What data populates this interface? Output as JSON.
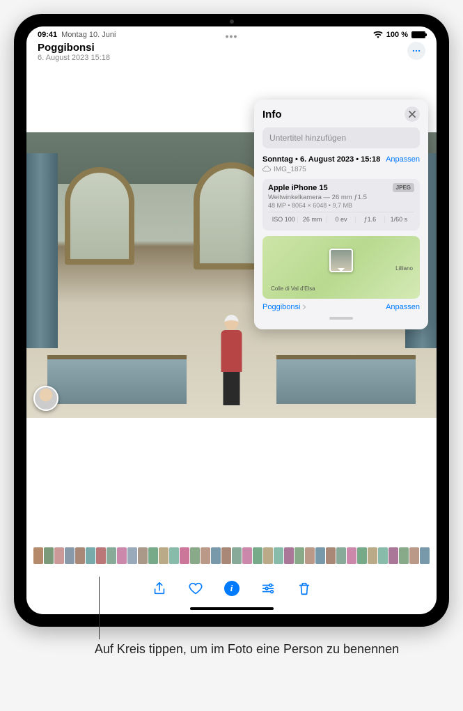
{
  "status": {
    "time": "09:41",
    "date": "Montag 10. Juni",
    "battery": "100 %"
  },
  "header": {
    "location": "Poggibonsi",
    "datetime": "6. August 2023  15:18"
  },
  "info_panel": {
    "title": "Info",
    "subtitle_placeholder": "Untertitel hinzufügen",
    "date_line": "Sonntag • 6. August 2023 • 15:18",
    "adjust": "Anpassen",
    "filename": "IMG_1875",
    "device": "Apple iPhone 15",
    "format_badge": "JPEG",
    "lens": "Weitwinkelkamera — 26 mm ƒ1.5",
    "resolution": "48 MP • 8064 × 6048 • 9,7 MB",
    "exif": {
      "iso": "ISO 100",
      "focal": "26 mm",
      "ev": "0 ev",
      "aperture": "ƒ1.6",
      "shutter": "1/60 s"
    },
    "map": {
      "label1": "Colle di Val d'Elsa",
      "label2": "Lilliano",
      "location_link": "Poggibonsi",
      "adjust": "Anpassen"
    }
  },
  "callout": "Auf Kreis tippen, um im Foto eine Person zu benennen",
  "thumb_colors": [
    "#b58a6a",
    "#7a9a7a",
    "#c99",
    "#89a",
    "#a87",
    "#7aa",
    "#b77",
    "#8a9",
    "#c8a",
    "#9ab",
    "#a98",
    "#7a8",
    "#ba8",
    "#8ba",
    "#c79",
    "#8a8",
    "#b98",
    "#79a",
    "#a87",
    "#8a9",
    "#c8a",
    "#7a8",
    "#ba8",
    "#8ba",
    "#a79",
    "#8a8",
    "#b98",
    "#79a",
    "#a87",
    "#8a9",
    "#c8a",
    "#7a8",
    "#ba8",
    "#8ba",
    "#a79",
    "#8a8",
    "#b98",
    "#79a"
  ]
}
